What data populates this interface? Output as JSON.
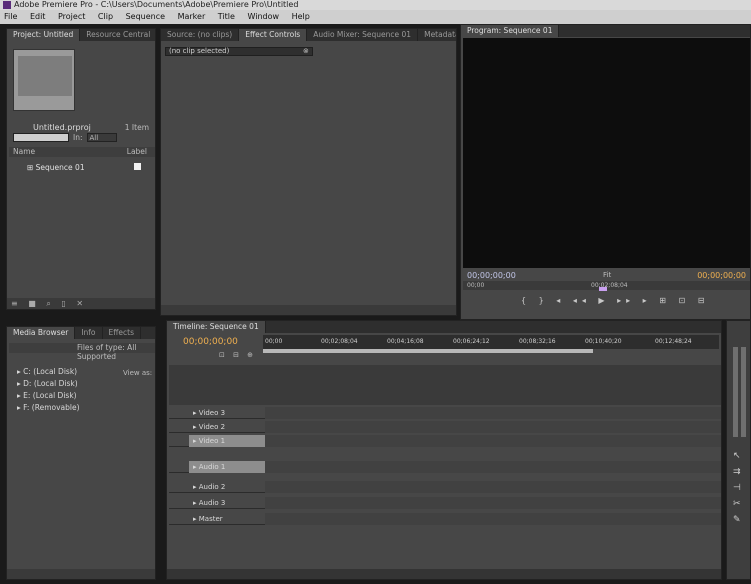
{
  "window": {
    "title": "Adobe Premiere Pro - C:\\Users\\Documents\\Adobe\\Premiere Pro\\Untitled"
  },
  "menu": [
    "File",
    "Edit",
    "Project",
    "Clip",
    "Sequence",
    "Marker",
    "Title",
    "Window",
    "Help"
  ],
  "project_panel": {
    "tabs": [
      "Project: Untitled",
      "Resource Central"
    ],
    "project_name": "Untitled.prproj",
    "item_count": "1 Item",
    "in_label": "In:",
    "in_value": "All",
    "columns": {
      "name": "Name",
      "label": "Label"
    },
    "items": [
      {
        "name": "Sequence 01"
      }
    ],
    "bottom_tools": "≡ ■ ⌕ ▯ ✕"
  },
  "source_panel": {
    "tabs": [
      "Source: (no clips)",
      "Effect Controls",
      "Audio Mixer: Sequence 01",
      "Metadata"
    ],
    "clip_chip": "(no clip selected)",
    "chip_close": "⊗"
  },
  "program_panel": {
    "tab": "Program: Sequence 01",
    "timecode_in": "00;00;00;00",
    "fit": "Fit",
    "timecode_duration": "00;00;00;00",
    "scale_left": "00;00",
    "scale_mid": "00;02;08;04",
    "transport": "{ } ◂ ◂◂ ▶ ▸▸ ▸ ⊞ ⊡ ⊟"
  },
  "media_browser": {
    "tabs": [
      "Media Browser",
      "Info",
      "Effects"
    ],
    "files_of_type": "Files of type: All Supported",
    "view_as": "View as:",
    "drives": [
      "C: (Local Disk)",
      "D: (Local Disk)",
      "E: (Local Disk)",
      "F: (Removable)"
    ]
  },
  "timeline": {
    "tab": "Timeline: Sequence 01",
    "timecode": "00;00;00;00",
    "ruler": [
      "00;00",
      "00;02;08;04",
      "00;04;16;08",
      "00;06;24;12",
      "00;08;32;16",
      "00;10;40;20",
      "00;12;48;24"
    ],
    "tools": "⊡ ⊟ ⊕",
    "tracks": [
      {
        "name": "▸ Video 3",
        "selected": false
      },
      {
        "name": "▸ Video 2",
        "selected": false
      },
      {
        "name": "▸ Video 1",
        "selected": true
      },
      {
        "name": "▸ Audio 1",
        "selected": true
      },
      {
        "name": "▸ Audio 2",
        "selected": false
      },
      {
        "name": "▸ Audio 3",
        "selected": false
      },
      {
        "name": "▸ Master",
        "selected": false
      }
    ]
  },
  "colors": {
    "timecode_orange": "#f0b050",
    "timecode_blue": "#c2c6e8",
    "panel_gray": "#474747"
  }
}
